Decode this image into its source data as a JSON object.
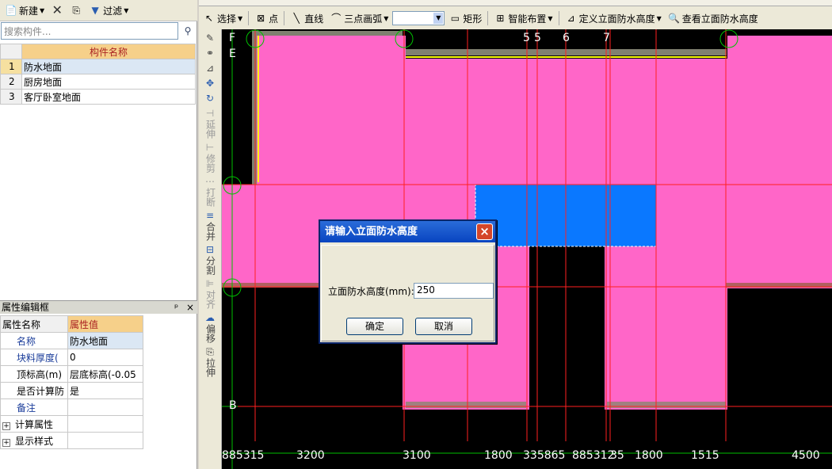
{
  "left_toolbar": {
    "new_label": "新建",
    "filter_label": "过滤"
  },
  "search": {
    "placeholder": "搜索构件..."
  },
  "component_list": {
    "header": "构件名称",
    "rows": [
      {
        "num": "1",
        "name": "防水地面"
      },
      {
        "num": "2",
        "name": "厨房地面"
      },
      {
        "num": "3",
        "name": "客厅卧室地面"
      }
    ]
  },
  "property_panel": {
    "title": "属性编辑框",
    "pin": "ᵖ",
    "close": "×",
    "col_name": "属性名称",
    "col_value": "属性值",
    "rows": [
      {
        "name": "名称",
        "value": "防水地面"
      },
      {
        "name": "块料厚度(",
        "value": "0"
      },
      {
        "name": "顶标高(m)",
        "value": "层底标高(-0.05"
      },
      {
        "name": "是否计算防",
        "value": "是"
      },
      {
        "name": "备注",
        "value": ""
      },
      {
        "name": "计算属性",
        "value": ""
      },
      {
        "name": "显示样式",
        "value": ""
      }
    ]
  },
  "top_toolbar": {
    "select": "选择",
    "point": "点",
    "line": "直线",
    "arc": "三点画弧",
    "rect": "矩形",
    "smart": "智能布置",
    "define_height": "定义立面防水高度",
    "view_height": "查看立面防水高度"
  },
  "vertical_toolbar": [
    "延伸",
    "修剪",
    "打断",
    "合并",
    "分割",
    "对齐",
    "偏移",
    "拉伸"
  ],
  "axis_labels": {
    "top": [
      "5",
      "5",
      "6",
      "7"
    ],
    "left": [
      "F",
      "E",
      "B"
    ]
  },
  "dimension_labels": [
    "885315",
    "3200",
    "3100",
    "1800",
    "335865",
    "885312",
    "35",
    "1800",
    "1515",
    "4500"
  ],
  "dialog": {
    "title": "请输入立面防水高度",
    "label": "立面防水高度(mm):",
    "value": "250",
    "ok": "确定",
    "cancel": "取消",
    "close": "×"
  },
  "colors": {
    "pink": "#ff66c8",
    "blue": "#0a78ff",
    "grid_red": "#ff2020",
    "grid_green": "#00c000"
  }
}
